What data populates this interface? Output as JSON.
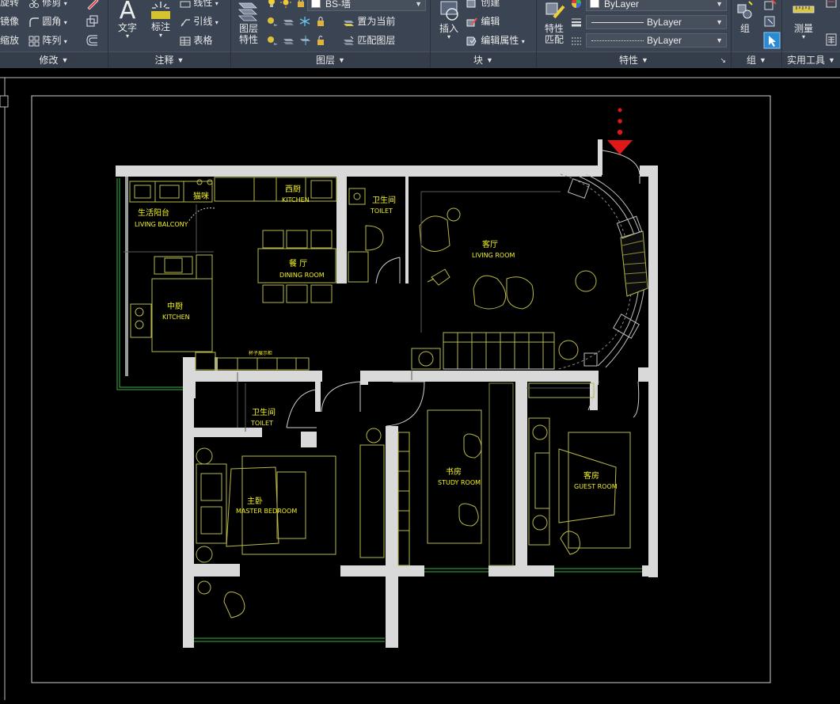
{
  "ribbon": {
    "modify": {
      "title": "修改",
      "rotate": "旋转",
      "mirror": "镜像",
      "scale": "缩放",
      "trim": "修剪",
      "fillet": "圆角",
      "array": "阵列"
    },
    "annotation": {
      "title": "注释",
      "text": "文字",
      "dimension": "标注",
      "linear": "线性",
      "leader": "引线",
      "table": "表格"
    },
    "layers": {
      "title": "图层",
      "layer_properties_l1": "图层",
      "layer_properties_l2": "特性",
      "current_layer": "BS-墙",
      "set_current": "置为当前",
      "match_layer": "匹配图层"
    },
    "block": {
      "title": "块",
      "insert": "插入",
      "create": "创建",
      "edit": "编辑",
      "edit_attributes": "编辑属性"
    },
    "properties": {
      "title": "特性",
      "match_l1": "特性",
      "match_l2": "匹配",
      "color": "ByLayer",
      "linetype": "ByLayer",
      "lineweight": "ByLayer"
    },
    "groups": {
      "title": "组",
      "group": "组"
    },
    "utilities": {
      "title": "实用工具",
      "measure": "测量"
    }
  },
  "plan": {
    "rooms": {
      "living_balcony_cn": "生活阳台",
      "living_balcony_en": "LIVING BALCONY",
      "cat_cn": "猫咪",
      "west_kitchen_cn": "西厨",
      "west_kitchen_en": "KITCHEN",
      "toilet1_cn": "卫生间",
      "toilet1_en": "TOILET",
      "living_cn": "客厅",
      "living_en": "LIVING ROOM",
      "dining_cn": "餐 厅",
      "dining_en": "DINING ROOM",
      "kitchen_cn": "中厨",
      "kitchen_en": "KITCHEN",
      "cabinet_label": "杯子展示柜",
      "toilet2_cn": "卫生间",
      "toilet2_en": "TOILET",
      "master_cn": "主卧",
      "master_en": "MASTER BEDROOM",
      "study_cn": "书房",
      "study_en": "STUDY ROOM",
      "guest_cn": "客房",
      "guest_en": "GUEST ROOM"
    }
  },
  "colors": {
    "ribbon_bg": "#3b4453",
    "canvas_bg": "#000000",
    "wall_fill": "#d9d9d9",
    "furniture": "#b9b84a",
    "room_text": "#f2f21e",
    "marker_red": "#e01818"
  }
}
